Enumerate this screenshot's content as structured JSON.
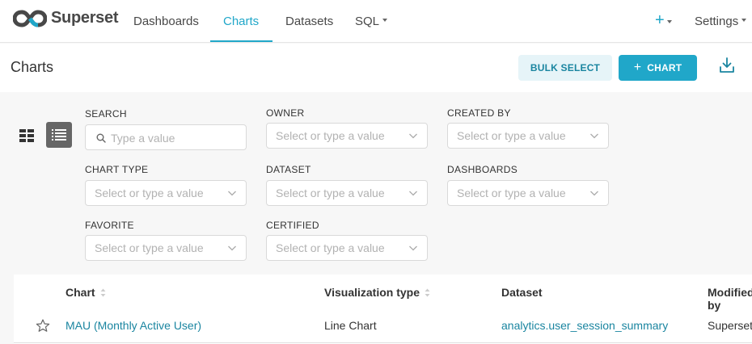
{
  "nav": {
    "brand": "Superset",
    "items": [
      {
        "label": "Dashboards"
      },
      {
        "label": "Charts"
      },
      {
        "label": "Datasets"
      },
      {
        "label": "SQL"
      }
    ],
    "plus_label": "+",
    "settings_label": "Settings"
  },
  "header": {
    "title": "Charts",
    "bulk_select_label": "BULK SELECT",
    "add_chart_label": "CHART"
  },
  "filters": {
    "search": {
      "label": "SEARCH",
      "placeholder": "Type a value"
    },
    "owner": {
      "label": "OWNER",
      "placeholder": "Select or type a value"
    },
    "created_by": {
      "label": "CREATED BY",
      "placeholder": "Select or type a value"
    },
    "chart_type": {
      "label": "CHART TYPE",
      "placeholder": "Select or type a value"
    },
    "dataset": {
      "label": "DATASET",
      "placeholder": "Select or type a value"
    },
    "dashboards": {
      "label": "DASHBOARDS",
      "placeholder": "Select or type a value"
    },
    "favorite": {
      "label": "FAVORITE",
      "placeholder": "Select or type a value"
    },
    "certified": {
      "label": "CERTIFIED",
      "placeholder": "Select or type a value"
    }
  },
  "table": {
    "columns": [
      "Chart",
      "Visualization type",
      "Dataset",
      "Modified by"
    ],
    "rows": [
      {
        "chart": "MAU (Monthly Active User)",
        "viz_type": "Line Chart",
        "dataset": "analytics.user_session_summary",
        "modified_by": "Superset"
      }
    ]
  },
  "colors": {
    "accent": "#20a7c9",
    "accent_light": "#e6f4f8",
    "link": "#1a85a0"
  },
  "icons": {
    "logo": "superset-logo-icon",
    "download": "download-icon",
    "card_view": "card-view-icon",
    "list_view": "list-view-icon",
    "search": "search-icon",
    "chevron": "chevron-down-icon",
    "sort": "sort-icon",
    "favorite": "star-icon"
  }
}
